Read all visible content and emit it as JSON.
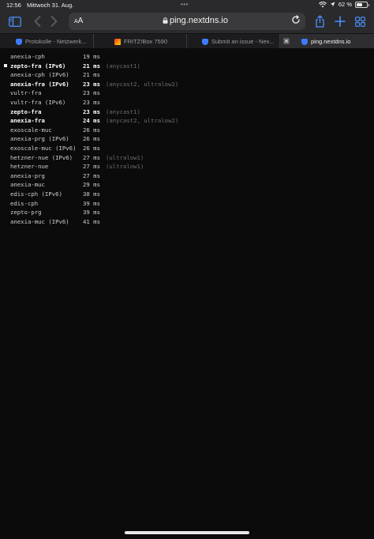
{
  "status_bar": {
    "time": "12:56",
    "date": "Mittwoch 31. Aug.",
    "dots": "•••",
    "battery_text": "62 %",
    "battery_level": 0.62
  },
  "toolbar": {
    "sidebar_icon": "sidebar-icon",
    "back_icon": "chevron-left-icon",
    "forward_icon": "chevron-right-icon",
    "text_size_label_small": "A",
    "text_size_label_large": "A",
    "lock_icon": "lock-icon",
    "address": "ping.nextdns.io",
    "reload_icon": "reload-icon",
    "share_icon": "share-icon",
    "new_tab_icon": "plus-icon",
    "tabs_overview_icon": "tab-overview-icon",
    "accent": "#4a90ff"
  },
  "tabs": [
    {
      "title": "Protokolle - Netzwerk...",
      "icon": "nextdns-shield-icon"
    },
    {
      "title": "FRITZ!Box 7590",
      "icon": "fritzbox-icon"
    },
    {
      "title": "Submit an issue - Nex...",
      "icon": "nextdns-shield-icon"
    },
    {
      "title": "ping.nextdns.io",
      "icon": "nextdns-shield-icon",
      "active": true
    }
  ],
  "results": [
    {
      "host": "anexia-cph",
      "ms": "19 ms",
      "note": "",
      "bold": false,
      "marked": false
    },
    {
      "host": "zepto-fra (IPv6)",
      "ms": "21 ms",
      "note": "(anycast1)",
      "bold": true,
      "marked": true
    },
    {
      "host": "anexia-cph (IPv6)",
      "ms": "21 ms",
      "note": "",
      "bold": false,
      "marked": false
    },
    {
      "host": "anexia-fra (IPv6)",
      "ms": "23 ms",
      "note": "(anycast2, ultralow2)",
      "bold": true,
      "marked": false
    },
    {
      "host": "vultr-fra",
      "ms": "23 ms",
      "note": "",
      "bold": false,
      "marked": false
    },
    {
      "host": "vultr-fra (IPv6)",
      "ms": "23 ms",
      "note": "",
      "bold": false,
      "marked": false
    },
    {
      "host": "zepto-fra",
      "ms": "23 ms",
      "note": "(anycast1)",
      "bold": true,
      "marked": false
    },
    {
      "host": "anexia-fra",
      "ms": "24 ms",
      "note": "(anycast2, ultralow2)",
      "bold": true,
      "marked": false
    },
    {
      "host": "exoscale-muc",
      "ms": "26 ms",
      "note": "",
      "bold": false,
      "marked": false
    },
    {
      "host": "anexia-prg (IPv6)",
      "ms": "26 ms",
      "note": "",
      "bold": false,
      "marked": false
    },
    {
      "host": "exoscale-muc (IPv6)",
      "ms": "26 ms",
      "note": "",
      "bold": false,
      "marked": false
    },
    {
      "host": "hetzner-nue (IPv6)",
      "ms": "27 ms",
      "note": "(ultralow1)",
      "bold": false,
      "marked": false
    },
    {
      "host": "hetzner-nue",
      "ms": "27 ms",
      "note": "(ultralow1)",
      "bold": false,
      "marked": false
    },
    {
      "host": "anexia-prg",
      "ms": "27 ms",
      "note": "",
      "bold": false,
      "marked": false
    },
    {
      "host": "anexia-muc",
      "ms": "29 ms",
      "note": "",
      "bold": false,
      "marked": false
    },
    {
      "host": "edis-cph (IPv6)",
      "ms": "38 ms",
      "note": "",
      "bold": false,
      "marked": false
    },
    {
      "host": "edis-cph",
      "ms": "39 ms",
      "note": "",
      "bold": false,
      "marked": false
    },
    {
      "host": "zepto-prg",
      "ms": "39 ms",
      "note": "",
      "bold": false,
      "marked": false
    },
    {
      "host": "anexia-muc (IPv6)",
      "ms": "41 ms",
      "note": "",
      "bold": false,
      "marked": false
    }
  ]
}
